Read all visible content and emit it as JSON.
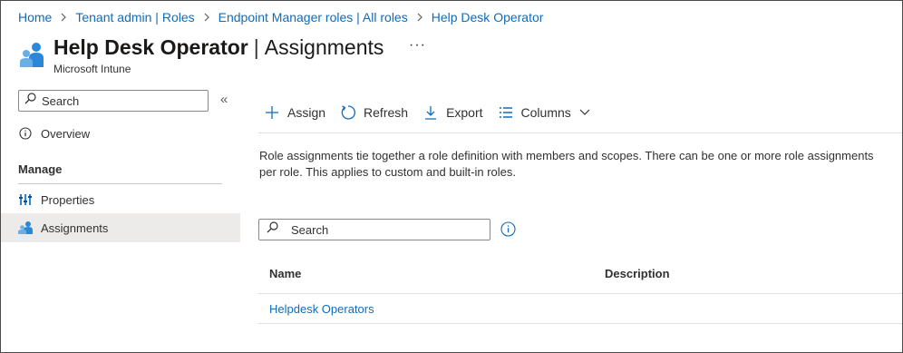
{
  "breadcrumb": [
    {
      "label": "Home"
    },
    {
      "label": "Tenant admin | Roles"
    },
    {
      "label": "Endpoint Manager roles | All roles"
    },
    {
      "label": "Help Desk Operator"
    }
  ],
  "header": {
    "title_main": "Help Desk Operator",
    "title_separator": "|",
    "title_sub": "Assignments",
    "more_label": "···",
    "subtitle": "Microsoft Intune",
    "icon": "role-users-icon"
  },
  "sidebar": {
    "search_placeholder": "Search",
    "collapse_label": "«",
    "overview": {
      "label": "Overview",
      "icon": "info-icon"
    },
    "section_title": "Manage",
    "items": [
      {
        "label": "Properties",
        "icon": "properties-icon",
        "active": false
      },
      {
        "label": "Assignments",
        "icon": "assignments-icon",
        "active": true
      }
    ]
  },
  "toolbar": {
    "assign_label": "Assign",
    "refresh_label": "Refresh",
    "export_label": "Export",
    "columns_label": "Columns"
  },
  "description": "Role assignments tie together a role definition with members and scopes. There can be one or more role assignments per role. This applies to custom and built-in roles.",
  "search": {
    "placeholder": "Search"
  },
  "table": {
    "columns": [
      "Name",
      "Description"
    ],
    "rows": [
      {
        "name": "Helpdesk Operators",
        "description": ""
      }
    ]
  },
  "colors": {
    "accent": "#0f6cbd",
    "text": "#323130",
    "active_nav_bg": "#edebe9",
    "icon_blue": "#2b88d8"
  }
}
